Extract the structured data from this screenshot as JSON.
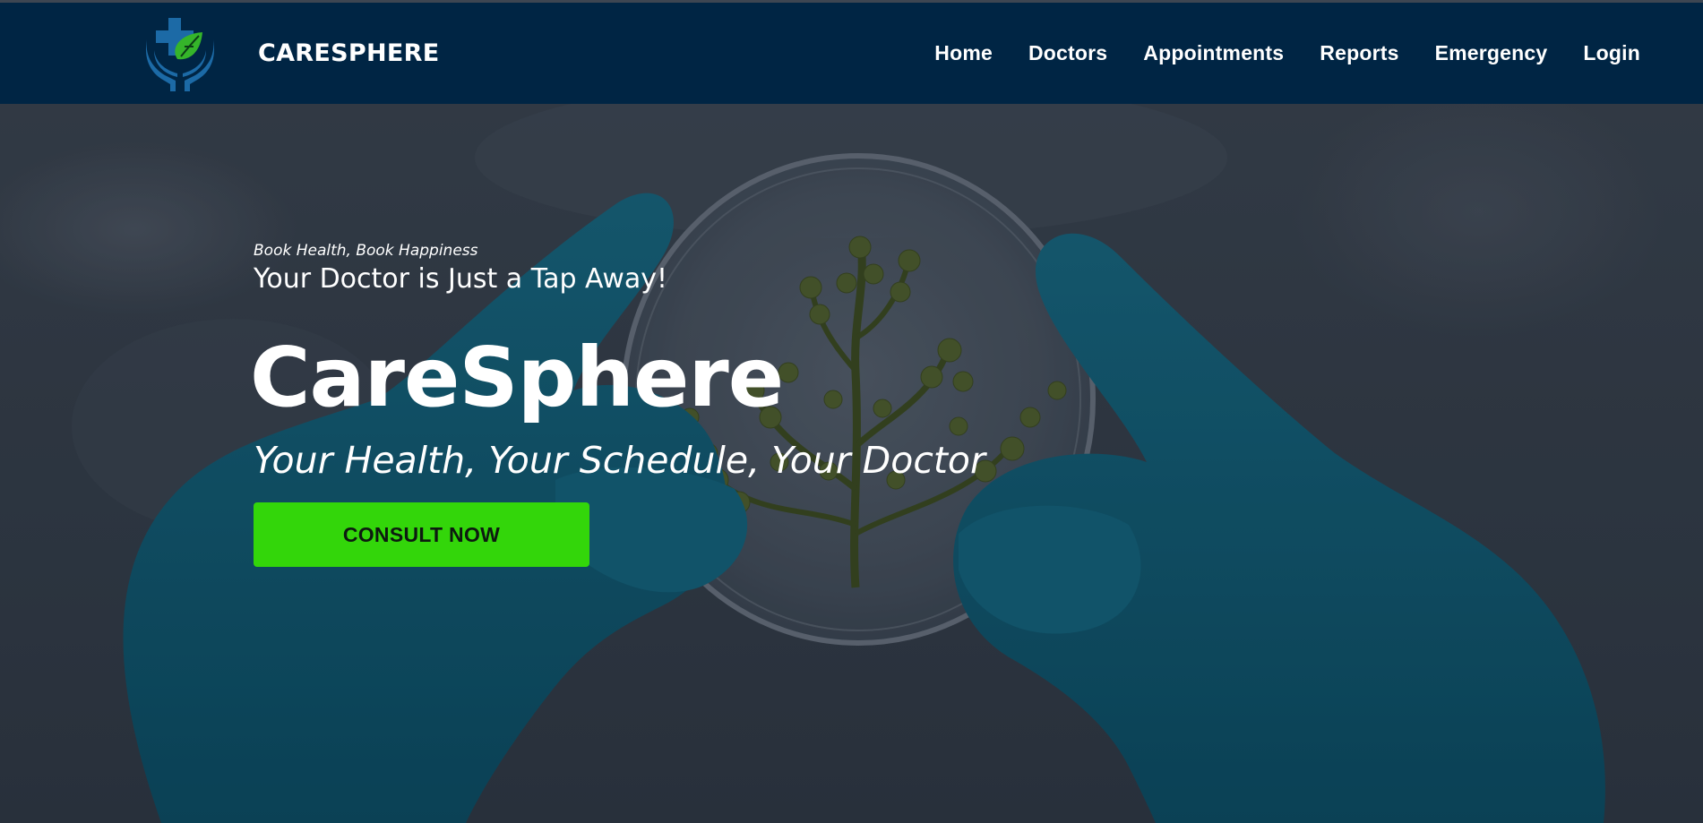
{
  "brand": {
    "name": "CARESPHERE",
    "logo_icon": "medical-cross-hands-leaf-icon",
    "colors": {
      "cross": "#1c6aa6",
      "hands": "#1c6aa6",
      "leaf": "#35b52a"
    }
  },
  "nav": {
    "items": [
      {
        "label": "Home"
      },
      {
        "label": "Doctors"
      },
      {
        "label": "Appointments"
      },
      {
        "label": "Reports"
      },
      {
        "label": "Emergency"
      },
      {
        "label": "Login"
      }
    ]
  },
  "hero": {
    "tagline_small": "Book Health, Book Happiness",
    "tagline_medium": "Your Doctor is Just a Tap Away!",
    "title": "CareSphere",
    "subtitle": "Your Health, Your Schedule, Your Doctor",
    "cta_label": "CONSULT NOW",
    "background_image": "gloved-hands-holding-petri-dish-with-plant-image"
  },
  "colors": {
    "navbar": "#002544",
    "cta": "#33d60a",
    "glove": "#0e5a72",
    "text": "#ffffff"
  }
}
